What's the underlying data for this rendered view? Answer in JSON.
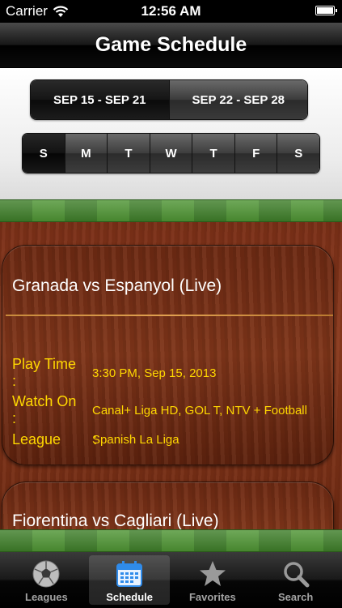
{
  "status_bar": {
    "carrier": "Carrier",
    "time": "12:56 AM",
    "wifi_icon": "wifi-icon",
    "battery_icon": "battery-icon"
  },
  "nav": {
    "title": "Game Schedule"
  },
  "week_selector": {
    "options": [
      "SEP 15 - SEP 21",
      "SEP 22 - SEP 28"
    ],
    "selected": "SEP 15 - SEP 21"
  },
  "day_selector": {
    "days": [
      "S",
      "M",
      "T",
      "W",
      "T",
      "F",
      "S"
    ],
    "selected": "S"
  },
  "games": [
    {
      "match": "Granada vs Espanyol (Live)",
      "play_time_label": "Play Time",
      "play_time": "3:30 PM, Sep 15, 2013",
      "watch_on_label": "Watch On",
      "watch_on": "Canal+ Liga HD, GOL T, NTV + Football",
      "league_label": "League",
      "league": "Spanish La Liga"
    },
    {
      "match": "Fiorentina vs Cagliari (Live)"
    }
  ],
  "tab_bar": {
    "tabs": [
      {
        "label": "Leagues",
        "icon": "soccer-ball-icon"
      },
      {
        "label": "Schedule",
        "icon": "calendar-icon",
        "active": true
      },
      {
        "label": "Favorites",
        "icon": "star-icon"
      },
      {
        "label": "Search",
        "icon": "magnifier-icon"
      }
    ]
  },
  "colors": {
    "label_text": "#ffd800",
    "wood": "#7a2f17",
    "grass": "#4f9534",
    "divider": "#e0a050"
  }
}
